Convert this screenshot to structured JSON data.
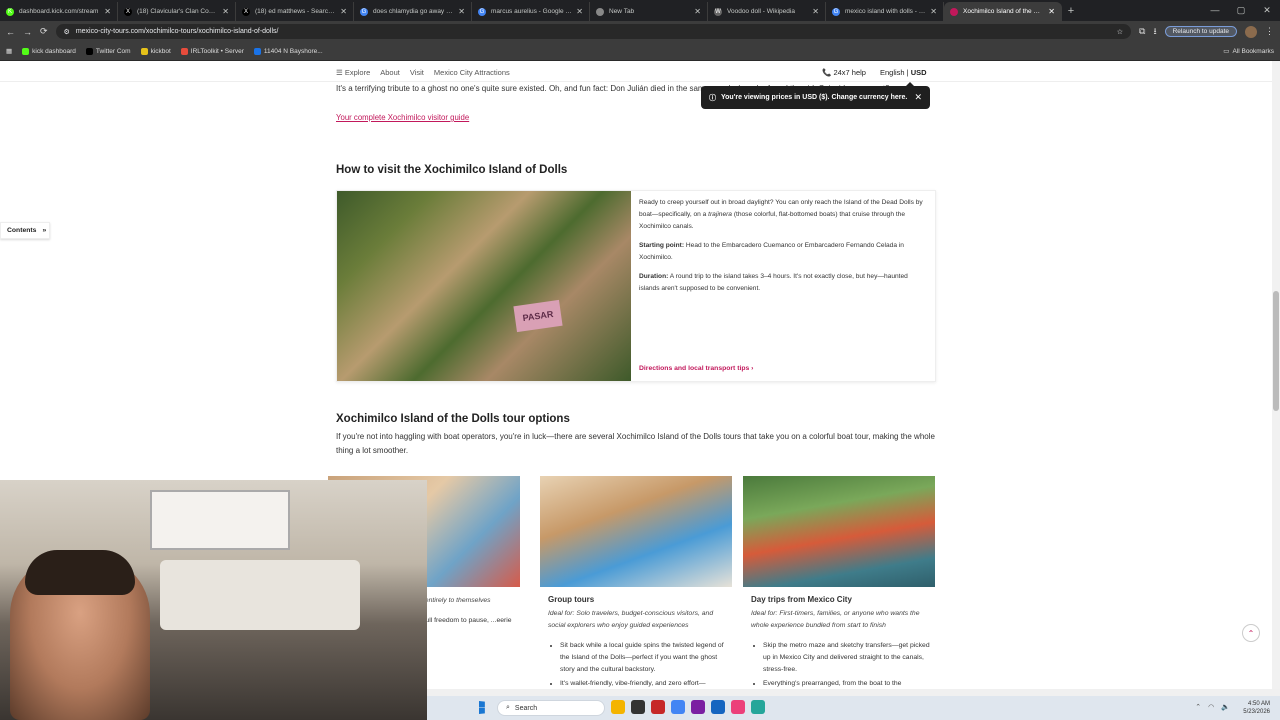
{
  "browser": {
    "tabs": [
      {
        "title": "dashboard.kick.com/stream",
        "fav": "K",
        "color": "#53fc18"
      },
      {
        "title": "(18) Clavicular's Clan Communi",
        "fav": "X",
        "color": "#000000"
      },
      {
        "title": "(18) ed matthews - Search / X",
        "fav": "X",
        "color": "#000000"
      },
      {
        "title": "does chlamydia go away - Goo",
        "fav": "G",
        "color": "#4285f4"
      },
      {
        "title": "marcus aurelius - Google Sear",
        "fav": "G",
        "color": "#4285f4"
      },
      {
        "title": "New Tab",
        "fav": "",
        "color": "#888888"
      },
      {
        "title": "Voodoo doll - Wikipedia",
        "fav": "W",
        "color": "#666666"
      },
      {
        "title": "mexico island with dolls - Goo",
        "fav": "G",
        "color": "#4285f4"
      },
      {
        "title": "Xochimilco Island of the Dolls",
        "fav": "",
        "color": "#c2185b"
      }
    ],
    "url": "mexico-city-tours.com/xochimilco-tours/xochimilco-island-of-dolls/",
    "relaunch": "Relaunch to update",
    "bookmarks": [
      {
        "label": "kick dashboard",
        "color": "#53fc18"
      },
      {
        "label": "Twitter Com",
        "color": "#000000"
      },
      {
        "label": "kickbot",
        "color": "#e6c21a"
      },
      {
        "label": "IRLToolkit • Server",
        "color": "#e74c3c"
      },
      {
        "label": "11404 N Bayshore...",
        "color": "#1a73e8"
      }
    ],
    "all_bookmarks": "All Bookmarks"
  },
  "site": {
    "nav": [
      "Explore",
      "About",
      "Visit",
      "Mexico City Attractions"
    ],
    "help": "24x7 help",
    "language": "English",
    "currency": "USD",
    "toast": "You're viewing prices in USD ($). Change currency here.",
    "contents": "Contents"
  },
  "article": {
    "para1": "It's a terrifying tribute to a ghost no one's quite sure existed. Oh, and fun fact: Don Julián died in the same canal where he found the girl. Coincidence or not?",
    "guide_link": "Your complete Xochimilco visitor guide",
    "h_visit": "How to visit the Xochimilco Island of Dolls",
    "sign": "PASAR",
    "visit_intro_1": "Ready to creep yourself out in broad daylight? You can only reach the Island of the Dead Dolls by boat—specifically, on a ",
    "visit_intro_em": "trajinera",
    "visit_intro_2": " (those colorful, flat-bottomed boats) that cruise through the Xochimilco canals.",
    "starting_label": "Starting point:",
    "starting_text": " Head to the Embarcadero Cuemanco or Embarcadero Fernando Celada in Xochimilco.",
    "duration_label": "Duration:",
    "duration_text": " A round trip to the island takes 3–4 hours. It's not exactly close, but hey—haunted islands aren't supposed to be convenient.",
    "directions": "Directions and local transport tips",
    "h_tours": "Xochimilco Island of the Dolls tour options",
    "tours_intro": "If you're not into haggling with boat operators, you're in luck—there are several Xochimilco Island of the Dolls tours that take you on a colorful boat tour, making the whole thing a lot smoother.",
    "cards": [
      {
        "title": "",
        "ideal": "...s, photographers, and ...ed entirely to themselves",
        "bullets": [
          "...th zero strangers, no ...full freedom to pause, ...eerie silence while the dolls"
        ]
      },
      {
        "title": "Group tours",
        "ideal": "Ideal for: Solo travelers, budget-conscious visitors, and social explorers who enjoy guided experiences",
        "bullets": [
          "Sit back while a local guide spins the twisted legend of the Island of the Dolls—perfect if you want the ghost story and the cultural backstory.",
          "It's wallet-friendly, vibe-friendly, and zero effort—"
        ]
      },
      {
        "title": "Day trips from Mexico City",
        "ideal": "Ideal for: First-timers, families, or anyone who wants the whole experience bundled from start to finish",
        "bullets": [
          "Skip the metro maze and sketchy transfers—get picked up in Mexico City and delivered straight to the canals, stress-free.",
          "Everything's prearranged, from the boat to the"
        ]
      }
    ]
  },
  "taskbar": {
    "search": "Search",
    "time": "4:50 AM",
    "date": "5/23/2026"
  }
}
